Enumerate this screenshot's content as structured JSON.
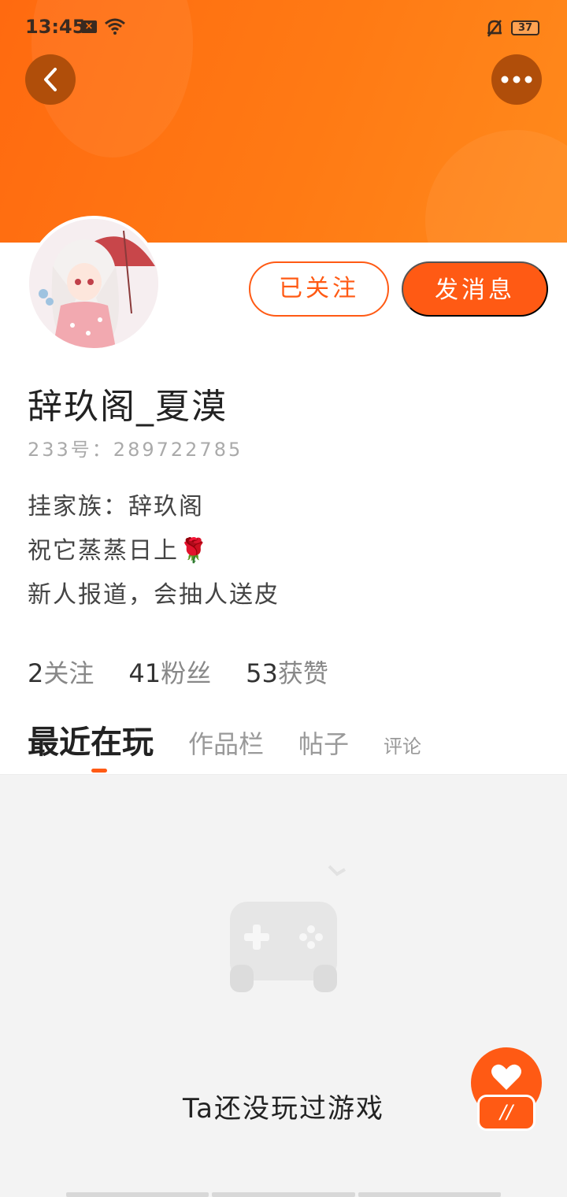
{
  "status_bar": {
    "time": "13:45",
    "battery": "37"
  },
  "header": {
    "back_icon": "chevron-left-icon",
    "more_icon": "more-dots-icon"
  },
  "profile": {
    "username": "辞玖阁_夏漠",
    "uid": "233号：289722785",
    "bio_lines": [
      "挂家族：辞玖阁",
      "祝它蒸蒸日上🌹",
      "新人报道，会抽人送皮"
    ]
  },
  "actions": {
    "follow_label": "已关注",
    "message_label": "发消息"
  },
  "stats": {
    "following_count": "2",
    "following_label": "关注",
    "fans_count": "41",
    "fans_label": "粉丝",
    "likes_count": "53",
    "likes_label": "获赞"
  },
  "tabs": [
    {
      "label": "最近在玩",
      "active": true
    },
    {
      "label": "作品栏",
      "active": false
    },
    {
      "label": "帖子",
      "active": false
    },
    {
      "label": "评论",
      "active": false
    }
  ],
  "empty_state": {
    "icon": "gamepad-icon",
    "text": "Ta还没玩过游戏"
  },
  "floating": {
    "icon": "heart-icon",
    "pill_text": "//"
  },
  "colors": {
    "accent": "#ff5a14",
    "header_gradient_start": "#ff6a10",
    "header_gradient_end": "#ff8a1c"
  }
}
